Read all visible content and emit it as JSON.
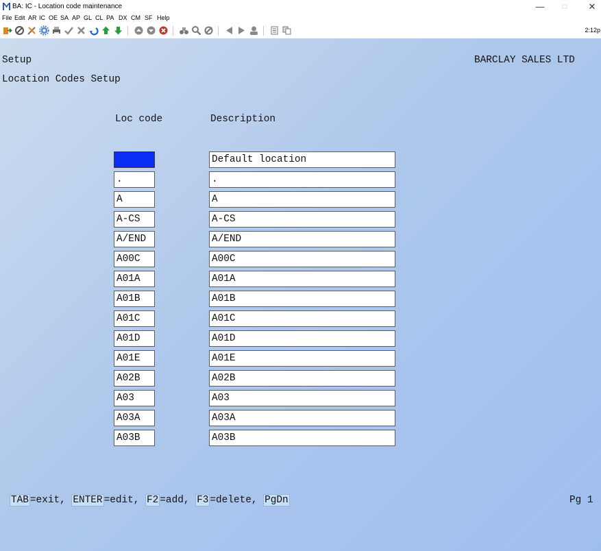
{
  "window": {
    "title": "BA: IC - Location code maintenance",
    "time": "2:12p"
  },
  "menu": [
    "File",
    "Edit",
    "AR",
    "IC",
    "OE",
    "SA",
    "AP",
    "GL",
    "CL",
    "PA",
    "DX",
    "CM",
    "SF",
    "Help"
  ],
  "toolbar_icons": [
    "exit-icon",
    "stop-icon",
    "tools-icon",
    "settings-icon",
    "print-icon",
    "check-icon",
    "cancel-icon",
    "undo-icon",
    "up-arrow-icon",
    "down-arrow-icon",
    "circle-up-icon",
    "circle-down-icon",
    "circle-x-icon",
    "binoculars-icon",
    "zoom-icon",
    "refresh-icon",
    "first-icon",
    "next-icon",
    "last-icon",
    "report-icon",
    "copy-icon"
  ],
  "header": {
    "section": "Setup",
    "company": "BARCLAY SALES LTD",
    "screen_title": "Location Codes Setup"
  },
  "columns": {
    "code": "Loc code",
    "description": "Description"
  },
  "rows": [
    {
      "code": "",
      "description": "Default location",
      "selected": true
    },
    {
      "code": ".",
      "description": "."
    },
    {
      "code": "A",
      "description": "A"
    },
    {
      "code": "A-CS",
      "description": "A-CS"
    },
    {
      "code": "A/END",
      "description": "A/END"
    },
    {
      "code": "A00C",
      "description": "A00C"
    },
    {
      "code": "A01A",
      "description": "A01A"
    },
    {
      "code": "A01B",
      "description": "A01B"
    },
    {
      "code": "A01C",
      "description": "A01C"
    },
    {
      "code": "A01D",
      "description": "A01D"
    },
    {
      "code": "A01E",
      "description": "A01E"
    },
    {
      "code": "A02B",
      "description": "A02B"
    },
    {
      "code": "A03",
      "description": "A03"
    },
    {
      "code": "A03A",
      "description": "A03A"
    },
    {
      "code": "A03B",
      "description": "A03B"
    }
  ],
  "footer": {
    "tab_key": "TAB",
    "tab_text": "=exit, ",
    "enter_key": "ENTER",
    "enter_text": "=edit, ",
    "f2_key": "F2",
    "f2_text": "=add, ",
    "f3_key": "F3",
    "f3_text": "=delete, ",
    "pgdn_key": "PgDn",
    "page": "Pg 1"
  },
  "colors": {
    "selected_field": "#0a2cf5",
    "key_highlight": "#c7dff7",
    "background_from": "#ccdcee",
    "background_to": "#9fbef0"
  }
}
